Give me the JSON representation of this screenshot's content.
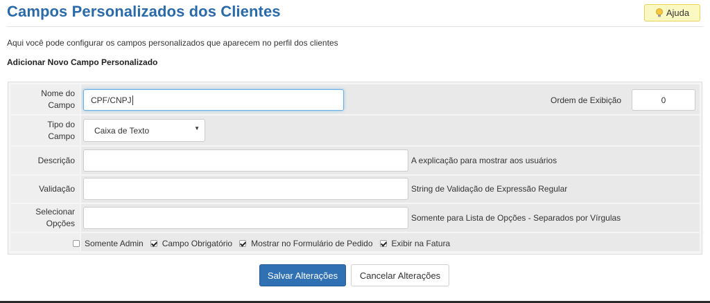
{
  "header": {
    "title": "Campos Personalizados dos Clientes",
    "help_label": "Ajuda",
    "help_icon": "lightbulb-icon"
  },
  "intro_text": "Aqui você pode configurar os campos personalizados que aparecem no perfil dos clientes",
  "section_title": "Adicionar Novo Campo Personalizado",
  "form": {
    "field_name": {
      "label_line1": "Nome do",
      "label_line2": "Campo",
      "value": "CPF/CNPJ"
    },
    "display_order": {
      "label": "Ordem de Exibição",
      "value": "0"
    },
    "field_type": {
      "label_line1": "Tipo do",
      "label_line2": "Campo",
      "selected": "Caixa de Texto"
    },
    "description": {
      "label": "Descrição",
      "value": "",
      "hint": "A explicação para mostrar aos usuários"
    },
    "validation": {
      "label": "Validação",
      "value": "",
      "hint": "String de Validação de Expressão Regular"
    },
    "options": {
      "label_line1": "Selecionar",
      "label_line2": "Opções",
      "value": "",
      "hint": "Somente para Lista de Opções - Separados por Vírgulas"
    },
    "checkboxes": [
      {
        "label": "Somente Admin",
        "checked": false
      },
      {
        "label": "Campo Obrigatório",
        "checked": true
      },
      {
        "label": "Mostrar no Formulário de Pedido",
        "checked": true
      },
      {
        "label": "Exibir na Fatura",
        "checked": true
      }
    ]
  },
  "actions": {
    "save_label": "Salvar Alterações",
    "cancel_label": "Cancelar Alterações"
  },
  "colors": {
    "title": "#2b6aa8",
    "primary_button": "#2f71b3",
    "help_button_bg": "#fcf8c2"
  }
}
